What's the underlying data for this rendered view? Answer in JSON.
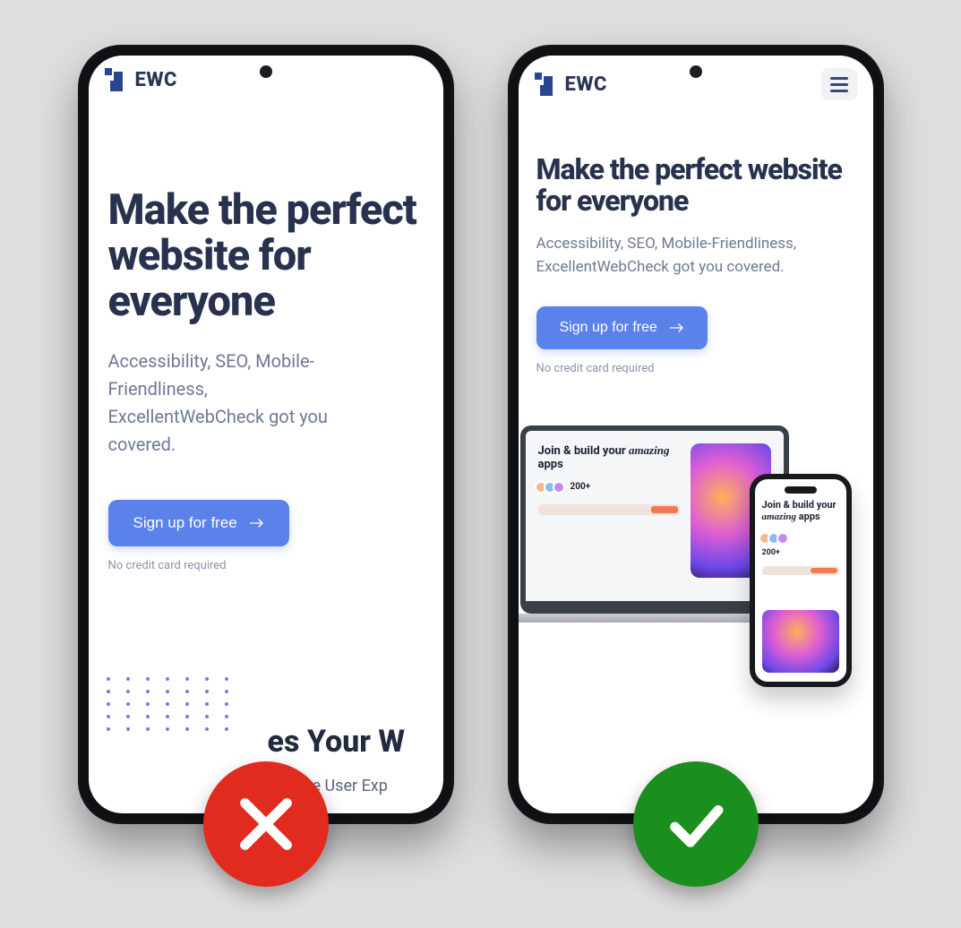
{
  "brand": {
    "name": "EWC"
  },
  "bad": {
    "title": "Make the perfect website for everyone",
    "subtitle": "Accessibility, SEO, Mobile-Friendliness, ExcellentWebCheck got you covered.",
    "cta": "Sign up for free",
    "note": "No credit card required",
    "clipped_heading": "es Your W",
    "clipped_subheading": "e User Exp"
  },
  "good": {
    "title": "Make the perfect website for everyone",
    "subtitle": "Accessibility, SEO, Mobile-Friendliness, ExcellentWebCheck got you covered.",
    "cta": "Sign up for free",
    "note": "No credit card required",
    "mock": {
      "title_prefix": "Join & build your ",
      "title_italic": "amazing",
      "title_suffix": " apps",
      "count": "200+"
    }
  }
}
